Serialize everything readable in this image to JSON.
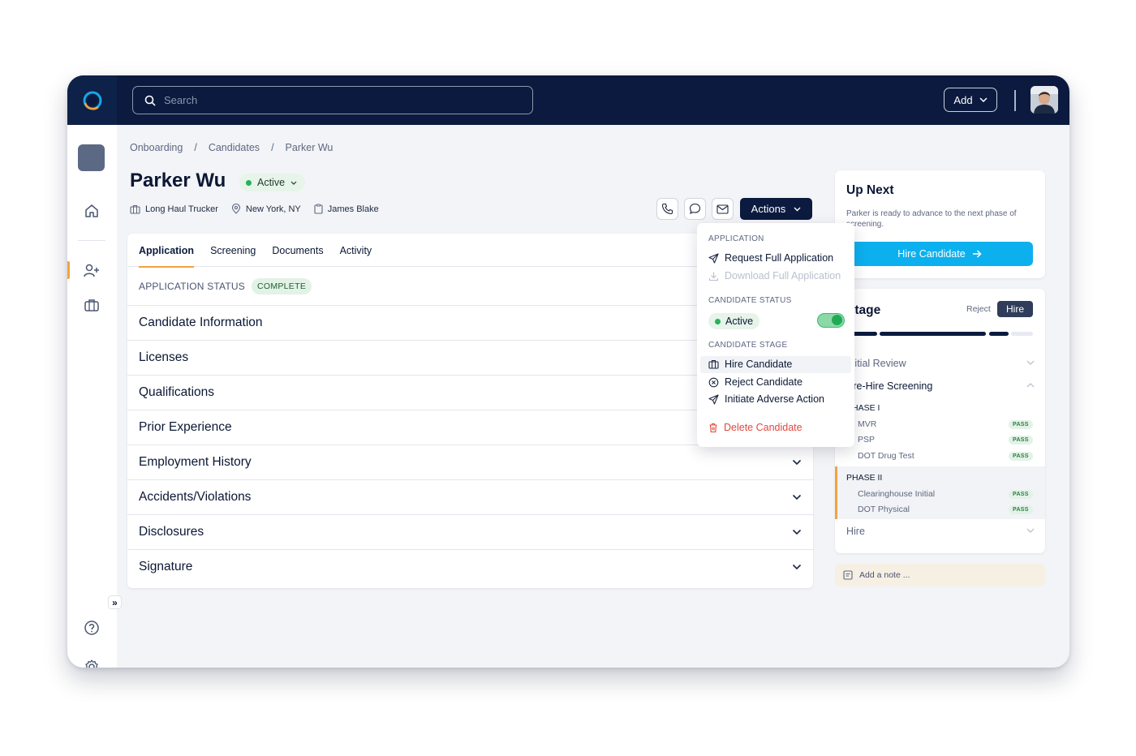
{
  "topbar": {
    "search_placeholder": "Search",
    "add_label": "Add"
  },
  "breadcrumb": [
    "Onboarding",
    "/",
    "Candidates",
    "/",
    "Parker Wu"
  ],
  "candidate": {
    "name": "Parker Wu",
    "status": "Active",
    "role": "Long Haul Trucker",
    "location": "New York, NY",
    "recruiter": "James Blake"
  },
  "actions_label": "Actions",
  "tabs": [
    "Application",
    "Screening",
    "Documents",
    "Activity"
  ],
  "application_status": {
    "label": "APPLICATION STATUS",
    "badge": "COMPLETE"
  },
  "sections": [
    "Candidate Information",
    "Licenses",
    "Qualifications",
    "Prior Experience",
    "Employment History",
    "Accidents/Violations",
    "Disclosures",
    "Signature"
  ],
  "dropdown": {
    "application_head": "APPLICATION",
    "request": "Request Full Application",
    "download": "Download Full Application",
    "status_head": "CANDIDATE STATUS",
    "status_value": "Active",
    "stage_head": "CANDIDATE STAGE",
    "hire": "Hire Candidate",
    "reject": "Reject Candidate",
    "adverse": "Initiate Adverse Action",
    "delete": "Delete Candidate"
  },
  "up_next": {
    "title": "Up Next",
    "text": "Parker is ready to advance to the next phase of screening.",
    "button": "Hire Candidate"
  },
  "stage": {
    "title": "Stage",
    "reject": "Reject",
    "hire": "Hire",
    "initial_review": "Initial Review",
    "pre_hire": "Pre-Hire Screening",
    "phase1": "PHASE I",
    "phase1_checks": [
      {
        "name": "MVR",
        "result": "PASS"
      },
      {
        "name": "PSP",
        "result": "PASS"
      },
      {
        "name": "DOT Drug Test",
        "result": "PASS"
      }
    ],
    "phase2": "PHASE II",
    "phase2_checks": [
      {
        "name": "Clearinghouse Initial",
        "result": "PASS"
      },
      {
        "name": "DOT Physical",
        "result": "PASS"
      }
    ],
    "hire_stage": "Hire"
  },
  "note_placeholder": "Add a note ...",
  "colors": {
    "navy": "#0b1a3e",
    "accent_orange": "#f3a33d",
    "cta_blue": "#0db0ee",
    "active_green": "#27b15a",
    "danger_red": "#e0493e"
  }
}
